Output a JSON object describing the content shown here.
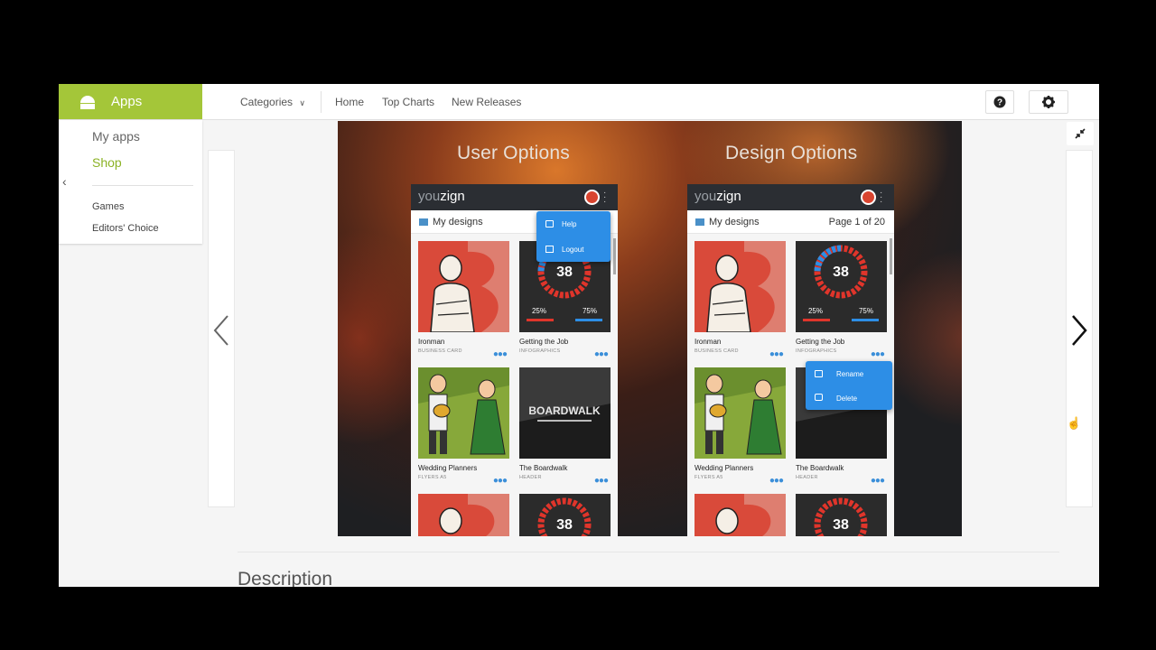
{
  "topbar": {
    "apps_label": "Apps",
    "nav": {
      "categories": "Categories",
      "home": "Home",
      "top_charts": "Top Charts",
      "new_releases": "New Releases"
    }
  },
  "sidebar": {
    "items": [
      {
        "label": "My apps"
      },
      {
        "label": "Shop"
      },
      {
        "label": "Games"
      },
      {
        "label": "Editors' Choice"
      }
    ]
  },
  "hero": {
    "left_heading": "User Options",
    "right_heading": "Design Options",
    "app_logo_a": "you",
    "app_logo_b": "zign",
    "section_title": "My designs",
    "page_indicator": "Page 1 of 20",
    "user_menu": [
      "Help",
      "Logout"
    ],
    "design_menu": [
      "Rename",
      "Delete"
    ],
    "gauge_value": "38",
    "gauge_left_pct": "25%",
    "gauge_right_pct": "75%",
    "boardwalk_text": "BOARDWALK",
    "cards": [
      {
        "name": "Ironman",
        "type": "BUSINESS CARD"
      },
      {
        "name": "Getting the Job",
        "type": "INFOGRAPHICS"
      },
      {
        "name": "Wedding Planners",
        "type": "FLYERS A5"
      },
      {
        "name": "The Boardwalk",
        "type": "HEADER"
      }
    ]
  },
  "description_heading": "Description",
  "colors": {
    "apps_green": "#a4c639",
    "shop_green": "#8bb224",
    "menu_blue": "#2d8ee6"
  }
}
